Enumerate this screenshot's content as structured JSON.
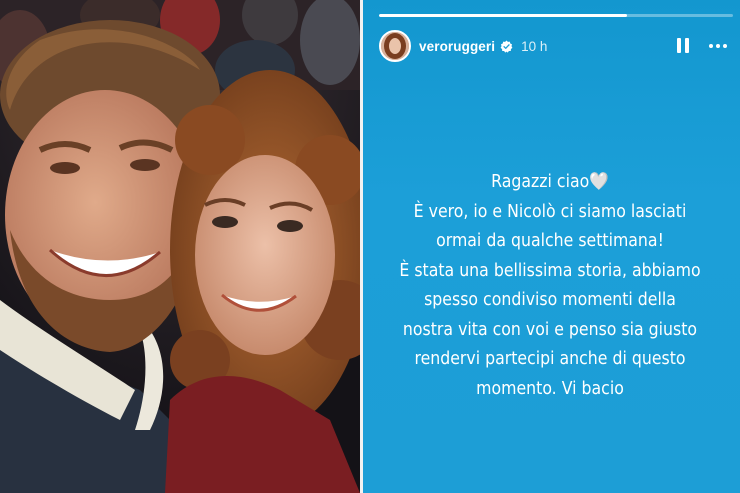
{
  "story": {
    "username": "veroruggeri",
    "time": "10 h",
    "progress": 0.7,
    "lines": [
      "Ragazzi ciao🤍",
      "È vero, io e Nicolò ci siamo lasciati",
      "ormai da qualche settimana!",
      "È stata una bellissima storia, abbiamo",
      "spesso condiviso momenti della",
      "nostra vita con voi e penso sia giusto",
      "rendervi partecipi anche di questo",
      "momento. Vi bacio"
    ]
  },
  "icons": {
    "verified": "verified-badge-icon",
    "pause": "pause-icon",
    "more": "more-options-icon"
  },
  "colors": {
    "story_background": "#1d9ed6",
    "text": "#ffffff"
  }
}
